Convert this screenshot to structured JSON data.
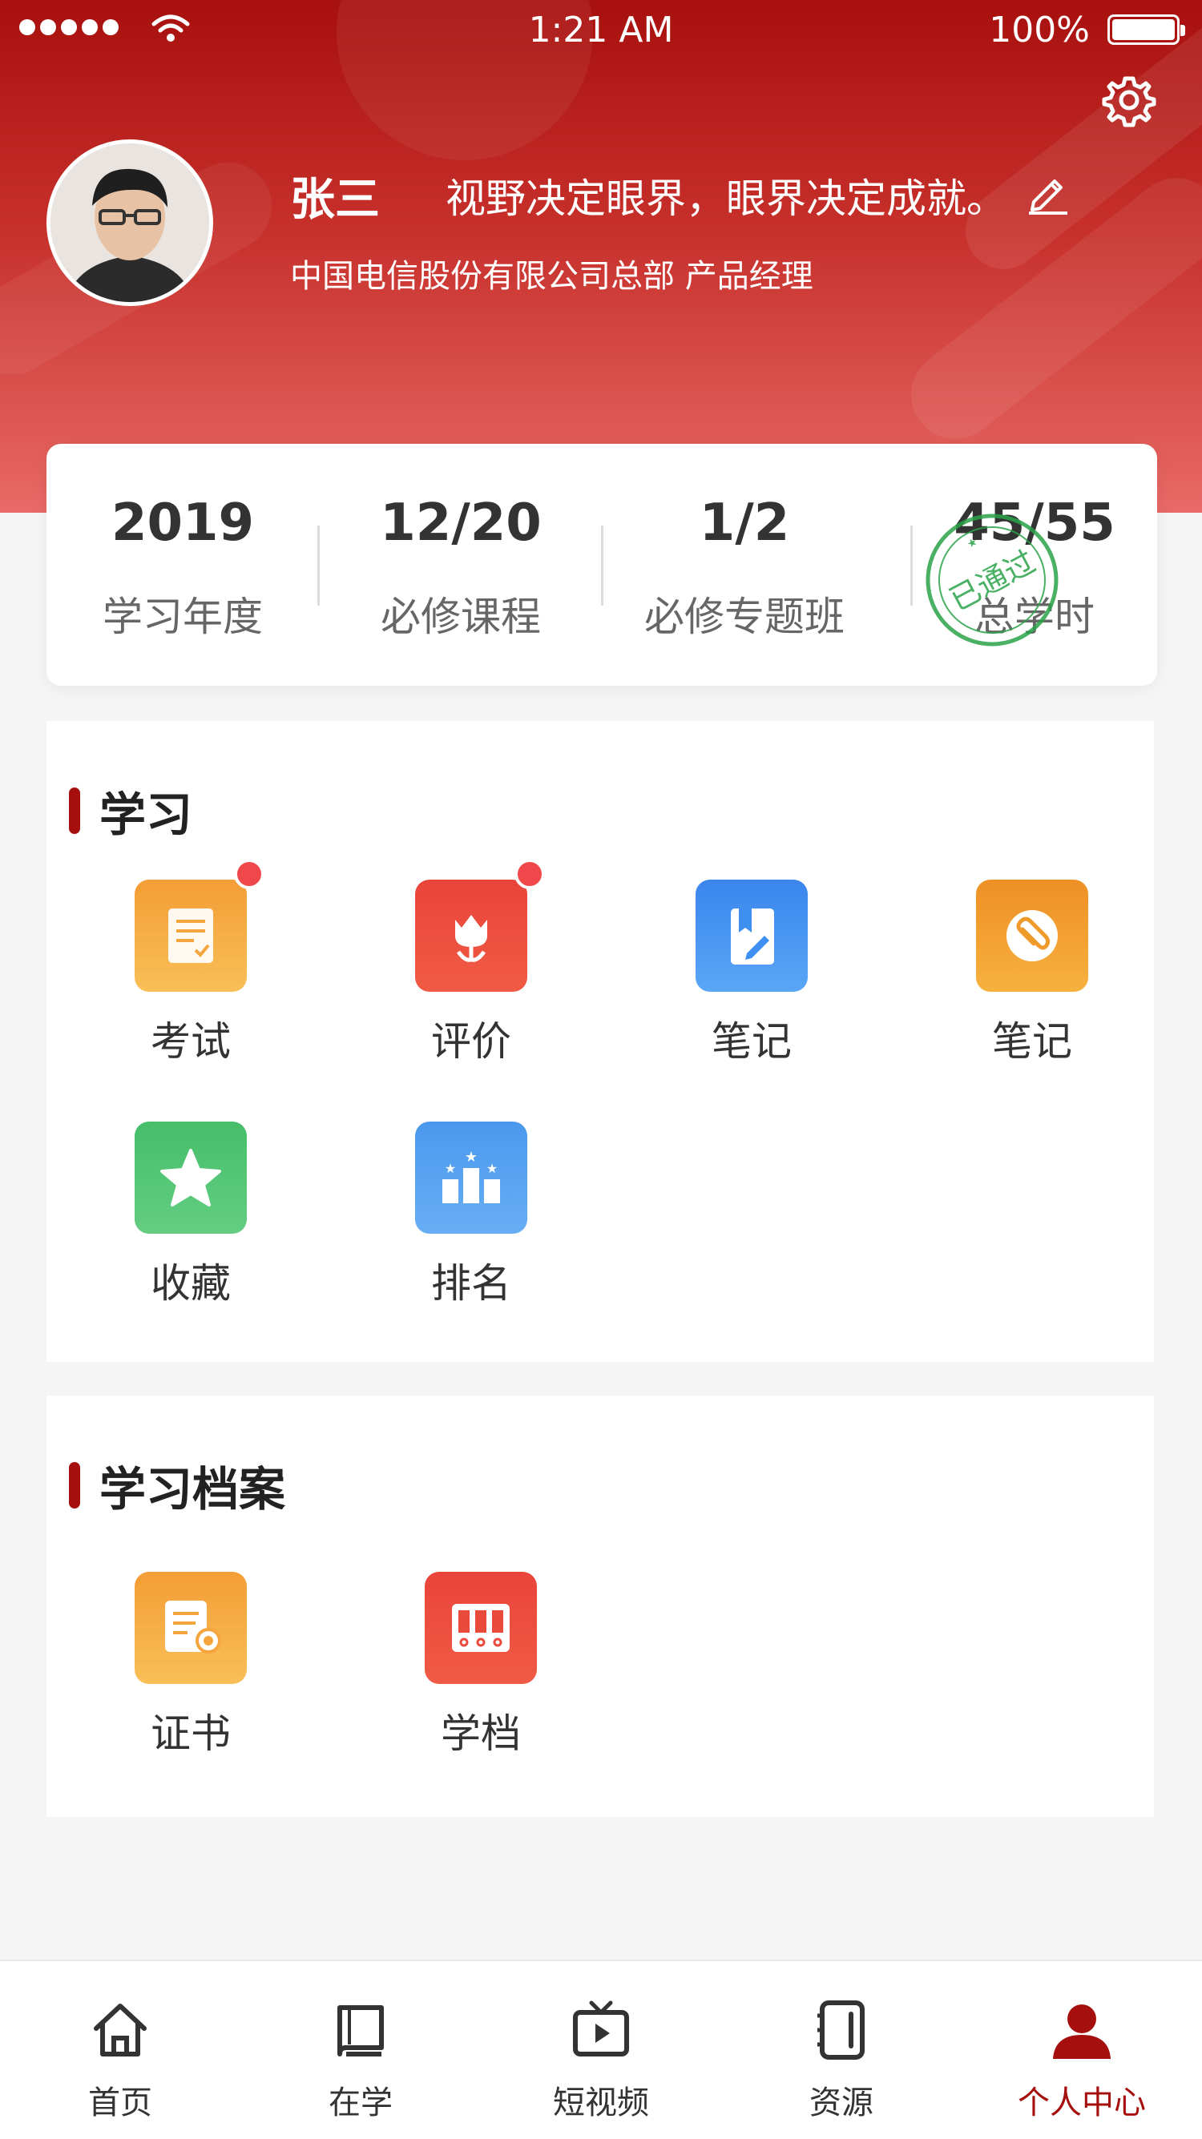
{
  "status_bar": {
    "time": "1:21 AM",
    "battery": "100%"
  },
  "profile": {
    "name": "张三",
    "motto": "视野决定眼界，眼界决定成就。",
    "organization": "中国电信股份有限公司总部  产品经理"
  },
  "stats": [
    {
      "value": "2019",
      "label": "学习年度"
    },
    {
      "value": "12/20",
      "label": "必修课程"
    },
    {
      "value": "1/2",
      "label": "必修专题班"
    },
    {
      "value": "45/55",
      "label": "总学时"
    }
  ],
  "stamp_text": "已通过",
  "learning": {
    "title": "学习",
    "items": [
      {
        "label": "考试",
        "icon": "exam-icon",
        "color": "#f6a93b",
        "badge": true
      },
      {
        "label": "评价",
        "icon": "flower-icon",
        "color": "#ea4a3c",
        "badge": true
      },
      {
        "label": "笔记",
        "icon": "notebook-pen-icon",
        "color": "#3f8ff0",
        "badge": false
      },
      {
        "label": "笔记",
        "icon": "paperclip-icon",
        "color": "#f09a2b",
        "badge": false
      },
      {
        "label": "收藏",
        "icon": "star-icon",
        "color": "#4cc271",
        "badge": false
      },
      {
        "label": "排名",
        "icon": "ranking-icon",
        "color": "#4d9df0",
        "badge": false
      }
    ]
  },
  "archive": {
    "title": "学习档案",
    "items": [
      {
        "label": "证书",
        "icon": "certificate-icon",
        "color": "#f6a93b"
      },
      {
        "label": "学档",
        "icon": "archive-folders-icon",
        "color": "#ea4a3c"
      }
    ]
  },
  "tabbar": [
    {
      "label": "首页",
      "icon": "home-icon",
      "active": false
    },
    {
      "label": "在学",
      "icon": "book-icon",
      "active": false
    },
    {
      "label": "短视频",
      "icon": "tv-play-icon",
      "active": false
    },
    {
      "label": "资源",
      "icon": "resource-icon",
      "active": false
    },
    {
      "label": "个人中心",
      "icon": "user-icon",
      "active": true
    }
  ],
  "colors": {
    "brand": "#a5100e",
    "badge": "#f0484a"
  }
}
